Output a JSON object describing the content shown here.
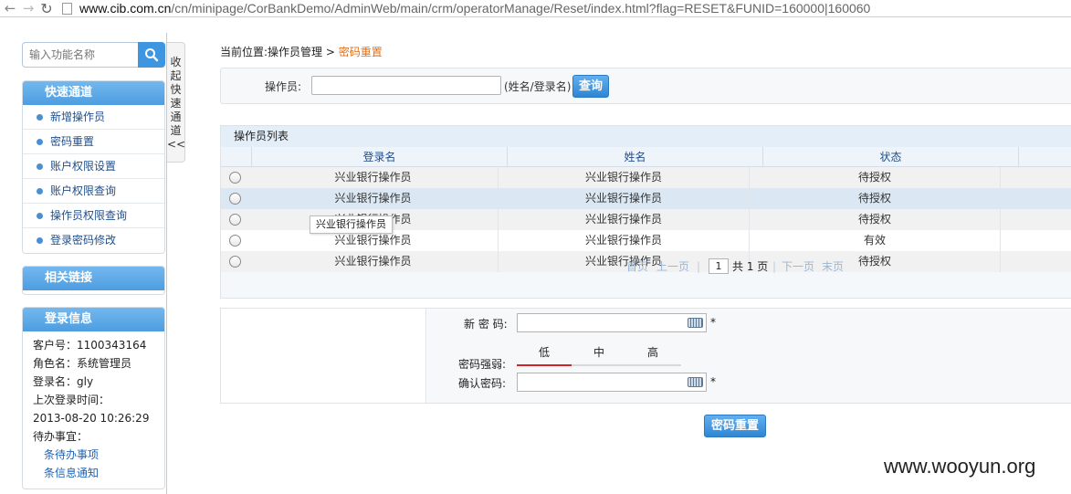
{
  "browser": {
    "url_host": "www.cib.com.cn",
    "url_path": "/cn/minipage/CorBankDemo/AdminWeb/main/crm/operatorManage/Reset/index.html?flag=RESET&FUNID=160000|160060"
  },
  "sidebar": {
    "search_placeholder": "输入功能名称",
    "quick_title": "快速通道",
    "quick_items": [
      {
        "label": "新增操作员"
      },
      {
        "label": "密码重置"
      },
      {
        "label": "账户权限设置"
      },
      {
        "label": "账户权限查询"
      },
      {
        "label": "操作员权限查询"
      },
      {
        "label": "登录密码修改"
      }
    ],
    "links_title": "相关链接",
    "login_title": "登录信息",
    "login_info": {
      "customer_no": "客户号：1100343164",
      "role": "角色名：系统管理员",
      "login_name": "登录名：gly",
      "last_login_label": "上次登录时间：",
      "last_login_time": "2013-08-20 10:26:29",
      "todo_label": "待办事宜：",
      "todo_link1": "条待办事项",
      "todo_link2": "条信息通知"
    },
    "collapse_label": "收起快速通道<<"
  },
  "breadcrumb": {
    "prefix": "当前位置:操作员管理 > ",
    "current": "密码重置"
  },
  "query": {
    "label": "操作员:",
    "value": "",
    "hint": "(姓名/登录名)",
    "button": "查询"
  },
  "list": {
    "title": "操作员列表",
    "columns": [
      "登录名",
      "姓名",
      "状态"
    ],
    "rows": [
      {
        "login": "兴业银行操作员",
        "name": "兴业银行操作员",
        "status": "待授权"
      },
      {
        "login": "兴业银行操作员",
        "name": "兴业银行操作员",
        "status": "待授权"
      },
      {
        "login": "兴业银行操作员",
        "name": "兴业银行操作员",
        "status": "待授权"
      },
      {
        "login": "兴业银行操作员",
        "name": "兴业银行操作员",
        "status": "有效"
      },
      {
        "login": "兴业银行操作员",
        "name": "兴业银行操作员",
        "status": "待授权"
      }
    ],
    "tooltip": "兴业银行操作员",
    "pager": {
      "first": "首页",
      "prev": "上一页",
      "sep": "|",
      "page": "1",
      "total": "共 1 页",
      "next": "下一页",
      "last": "末页"
    }
  },
  "password": {
    "new_label": "新 密 码:",
    "strength_label": "密码强弱:",
    "strength_levels": [
      "低",
      "中",
      "高"
    ],
    "strength_level": 1,
    "confirm_label": "确认密码:",
    "required_mark": "*"
  },
  "reset_button": "密码重置",
  "watermark": "www.wooyun.org",
  "colors": {
    "accent": "#3f96e0",
    "breadcrumb_current": "#e0701a",
    "strength_low": "#d0242a"
  }
}
